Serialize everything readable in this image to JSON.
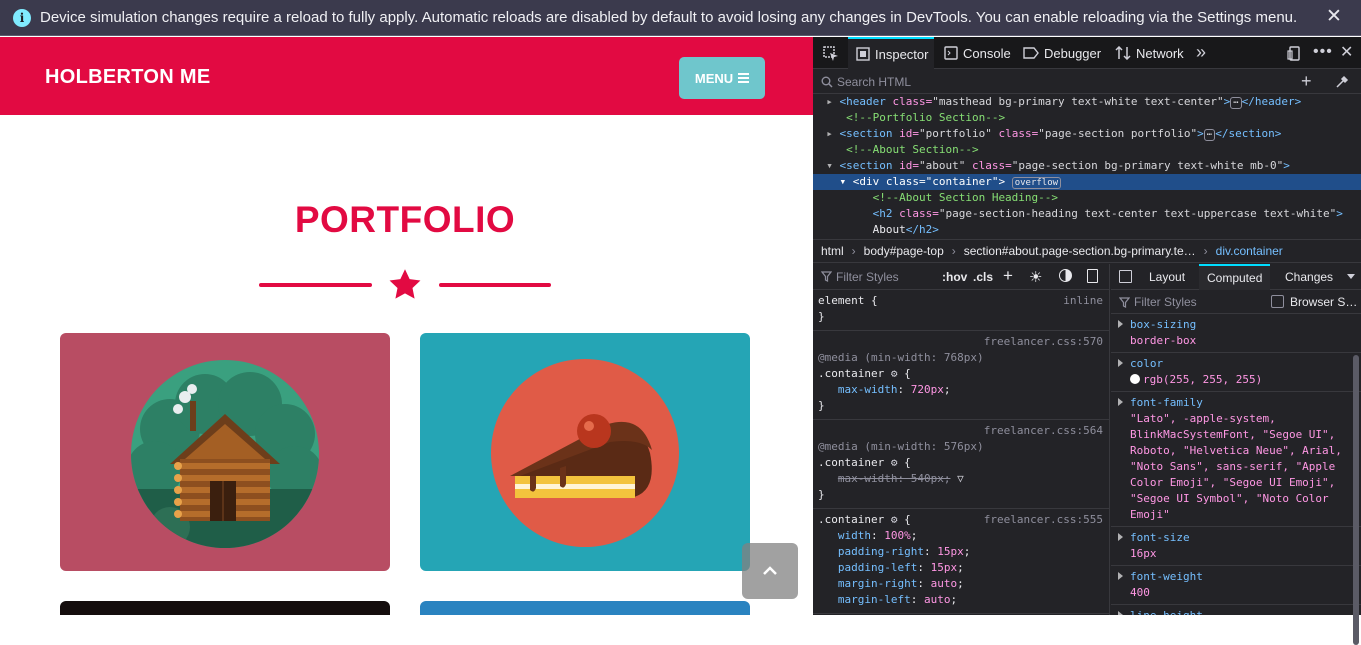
{
  "notification": {
    "icon": "info-icon",
    "message": "Device simulation changes require a reload to fully apply. Automatic reloads are disabled by default to avoid losing any changes in DevTools. You can enable reloading via the Settings menu.",
    "close_label": "✕"
  },
  "page": {
    "brand": "HOLBERTON ME",
    "menu_label": "MENU",
    "portfolio_heading": "PORTFOLIO",
    "colors": {
      "primary": "#e20a42",
      "menu": "#6fc6cc"
    }
  },
  "devtools": {
    "tabs": [
      "Inspector",
      "Console",
      "Debugger",
      "Network"
    ],
    "more_tabs": "»",
    "search_placeholder": "Search HTML",
    "markup": {
      "l1_tag": "<header",
      "l1_attr": " class=",
      "l1_val": "\"masthead bg-primary text-white text-center\"",
      "l1_close": "</header>",
      "l2_comment": "<!--Portfolio Section-->",
      "l3_tag": "<section",
      "l3_attr1": " id=",
      "l3_val1": "\"portfolio\"",
      "l3_attr2": " class=",
      "l3_val2": "\"page-section portfolio\"",
      "l3_close": "</section>",
      "l4_comment": "<!--About Section-->",
      "l5_tag": "<section",
      "l5_attr1": " id=",
      "l5_val1": "\"about\"",
      "l5_attr2": " class=",
      "l5_val2": "\"page-section bg-primary text-white mb-0\"",
      "l5_end": ">",
      "l6_tag": "<div",
      "l6_attr": " class=",
      "l6_val": "\"container\"",
      "l6_end": ">",
      "l6_badge": "overflow",
      "l7_comment": "<!--About Section Heading-->",
      "l8_tag": "<h2",
      "l8_attr": " class=",
      "l8_val": "\"page-section-heading text-center text-uppercase text-white\"",
      "l8_end": ">",
      "l9_text": "About",
      "l9_close": "</h2>",
      "ellipsis": "⋯"
    },
    "breadcrumbs": [
      "html",
      "body#page-top",
      "section#about.page-section.bg-primary.te…",
      "div.container"
    ],
    "rules_filter": "Filter Styles",
    "hov": ":hov",
    "cls": ".cls",
    "rules": {
      "r1_sel": "element {",
      "r1_src": "inline",
      "r1_end": "}",
      "r2_src": "freelancer.css:570",
      "r2_media": "@media (min-width: 768px)",
      "r2_sel": ".container",
      "r2_open": "{",
      "r2_prop": "max-width",
      "r2_val": "720px",
      "r2_end": "}",
      "r3_src": "freelancer.css:564",
      "r3_media": "@media (min-width: 576px)",
      "r3_sel": ".container",
      "r3_open": "{",
      "r3_decl": "max-width: 540px;",
      "r3_end": "}",
      "r4_src": "freelancer.css:555",
      "r4_sel": ".container",
      "r4_open": "{",
      "r4_p1": "width",
      "r4_v1": "100%",
      "r4_p2": "padding-right",
      "r4_v2": "15px",
      "r4_p3": "padding-left",
      "r4_v3": "15px",
      "r4_p4": "margin-right",
      "r4_v4": "auto",
      "r4_p5": "margin-left",
      "r4_v5": "auto"
    },
    "side_tabs": [
      "Layout",
      "Computed",
      "Changes"
    ],
    "computed_filter": "Filter Styles",
    "browser_styles": "Browser S…",
    "computed": {
      "p1": "box-sizing",
      "v1": "border-box",
      "p2": "color",
      "v2": "rgb(255, 255, 255)",
      "p3": "font-family",
      "v3": "\"Lato\", -apple-system, BlinkMacSystemFont, \"Segoe UI\", Roboto, \"Helvetica Neue\", Arial, \"Noto Sans\", sans-serif, \"Apple Color Emoji\", \"Segoe UI Emoji\", \"Segoe UI Symbol\", \"Noto Color Emoji\"",
      "p4": "font-size",
      "v4": "16px",
      "p5": "font-weight",
      "v5": "400",
      "p6": "line-height"
    }
  }
}
